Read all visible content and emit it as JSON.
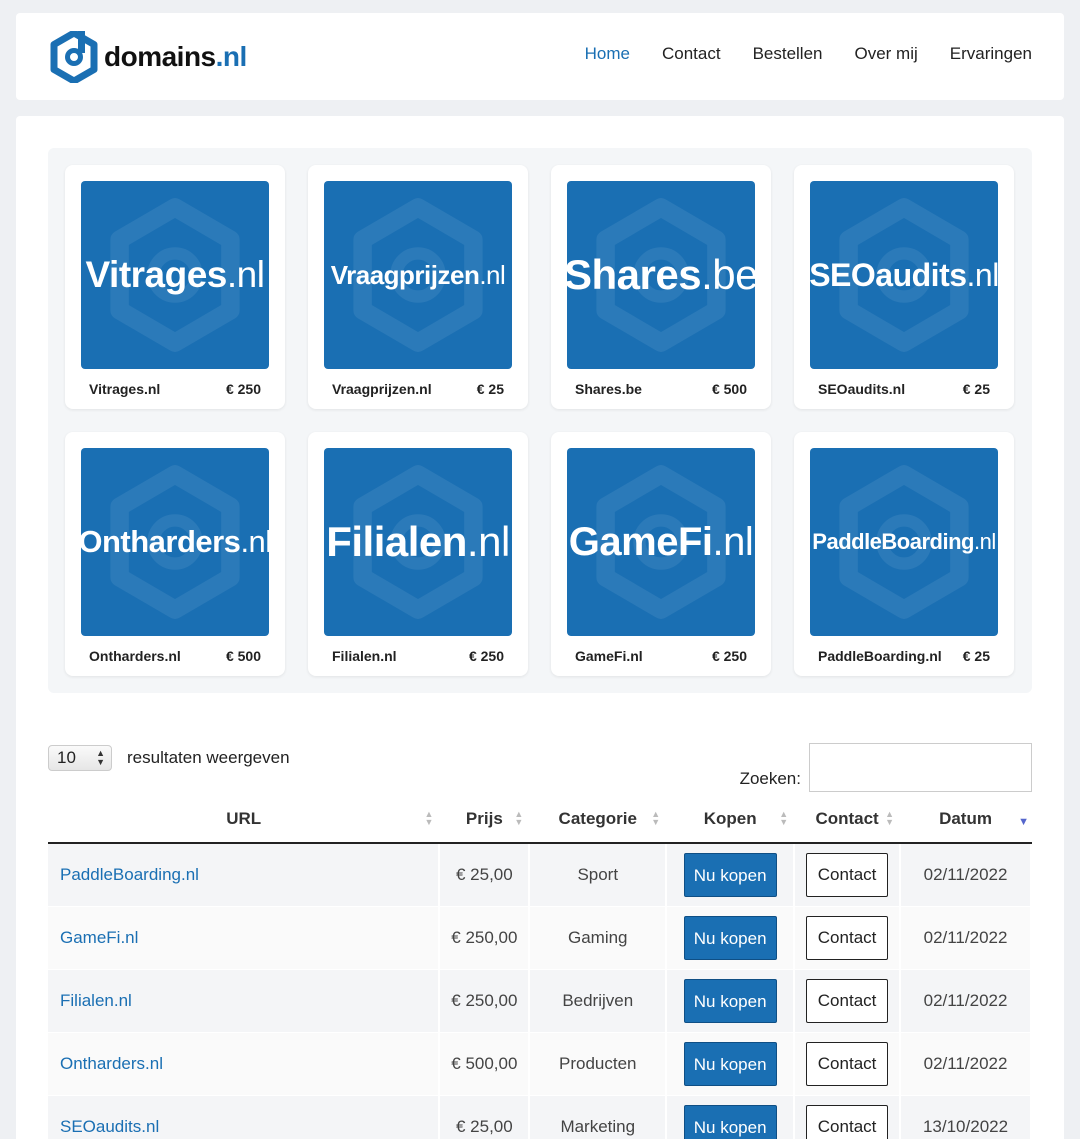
{
  "brand": {
    "name": "domains",
    "tld": ".nl",
    "logo_icon": "hexagon-d-logo-icon",
    "color": "#1a6fb3"
  },
  "nav": [
    {
      "label": "Home",
      "active": true
    },
    {
      "label": "Contact",
      "active": false
    },
    {
      "label": "Bestellen",
      "active": false
    },
    {
      "label": "Over mij",
      "active": false
    },
    {
      "label": "Ervaringen",
      "active": false
    }
  ],
  "cards": [
    {
      "thumb_name": "Vitrages",
      "thumb_tld": ".nl",
      "name": "Vitrages.nl",
      "price": "€ 250"
    },
    {
      "thumb_name": "Vraagprijzen",
      "thumb_tld": ".nl",
      "name": "Vraagprijzen.nl",
      "price": "€ 25"
    },
    {
      "thumb_name": "Shares",
      "thumb_tld": ".be",
      "name": "Shares.be",
      "price": "€ 500"
    },
    {
      "thumb_name": "SEOaudits",
      "thumb_tld": ".nl",
      "name": "SEOaudits.nl",
      "price": "€ 25"
    },
    {
      "thumb_name": "Ontharders",
      "thumb_tld": ".nl",
      "name": "Ontharders.nl",
      "price": "€ 500"
    },
    {
      "thumb_name": "Filialen",
      "thumb_tld": ".nl",
      "name": "Filialen.nl",
      "price": "€ 250"
    },
    {
      "thumb_name": "GameFi",
      "thumb_tld": ".nl",
      "name": "GameFi.nl",
      "price": "€ 250"
    },
    {
      "thumb_name": "PaddleBoarding",
      "thumb_tld": ".nl",
      "name": "PaddleBoarding.nl",
      "price": "€ 25"
    }
  ],
  "table_controls": {
    "page_length": "10",
    "length_label": "resultaten weergeven",
    "search_label": "Zoeken:",
    "search_value": ""
  },
  "table": {
    "columns": [
      "URL",
      "Prijs",
      "Categorie",
      "Kopen",
      "Contact",
      "Datum"
    ],
    "sorted_column": "Datum",
    "buy_label": "Nu kopen",
    "contact_label": "Contact",
    "rows": [
      {
        "url": "PaddleBoarding.nl",
        "price": "€ 25,00",
        "category": "Sport",
        "date": "02/11/2022"
      },
      {
        "url": "GameFi.nl",
        "price": "€ 250,00",
        "category": "Gaming",
        "date": "02/11/2022"
      },
      {
        "url": "Filialen.nl",
        "price": "€ 250,00",
        "category": "Bedrijven",
        "date": "02/11/2022"
      },
      {
        "url": "Ontharders.nl",
        "price": "€ 500,00",
        "category": "Producten",
        "date": "02/11/2022"
      },
      {
        "url": "SEOaudits.nl",
        "price": "€ 25,00",
        "category": "Marketing",
        "date": "13/10/2022"
      }
    ]
  }
}
